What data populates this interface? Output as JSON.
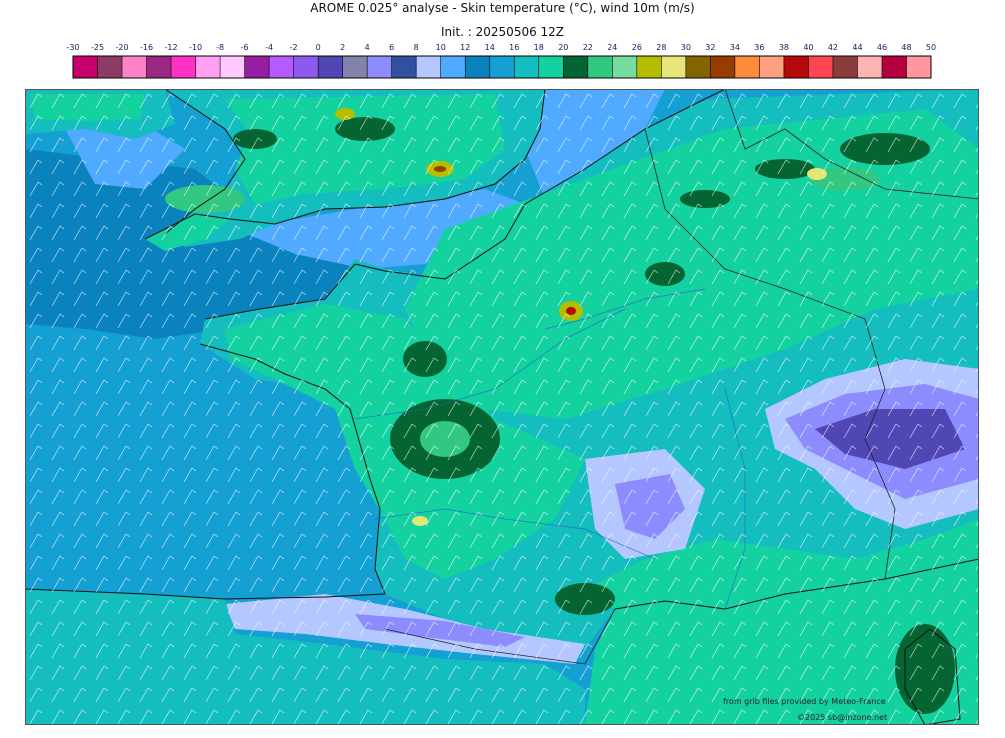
{
  "title": "AROME 0.025° analyse - Skin temperature (°C), wind 10m (m/s)",
  "init": "Init. : 20250506 12Z",
  "colorbar": {
    "labels": [
      "-30",
      "-25",
      "-20",
      "-16",
      "-12",
      "-10",
      "-8",
      "-6",
      "-4",
      "-2",
      "0",
      "2",
      "4",
      "6",
      "8",
      "10",
      "12",
      "14",
      "16",
      "18",
      "20",
      "22",
      "24",
      "26",
      "28",
      "30",
      "32",
      "34",
      "36",
      "38",
      "40",
      "42",
      "44",
      "46",
      "48",
      "50"
    ],
    "colors": [
      "#c8006e",
      "#8c3c64",
      "#ff82c8",
      "#9b2882",
      "#ff32c8",
      "#ffa0f0",
      "#ffc8ff",
      "#961ea0",
      "#b45aff",
      "#8c5af0",
      "#5046b4",
      "#8282aa",
      "#8c8cff",
      "#3250a0",
      "#b4c8ff",
      "#50aaff",
      "#0a82be",
      "#14a0d2",
      "#14bebe",
      "#14d2a0",
      "#046432",
      "#32c882",
      "#78dca0",
      "#b4be00",
      "#e6e678",
      "#826400",
      "#963c00",
      "#ff8c3c",
      "#ffa082",
      "#b40a0a",
      "#ff4650",
      "#8c3c3c",
      "#ffb4b4",
      "#b4003c",
      "#ff96a0"
    ]
  },
  "credits": {
    "source": "from grib files provided by Meteo-France",
    "copyright": "©2025 sb@inzone.net"
  }
}
